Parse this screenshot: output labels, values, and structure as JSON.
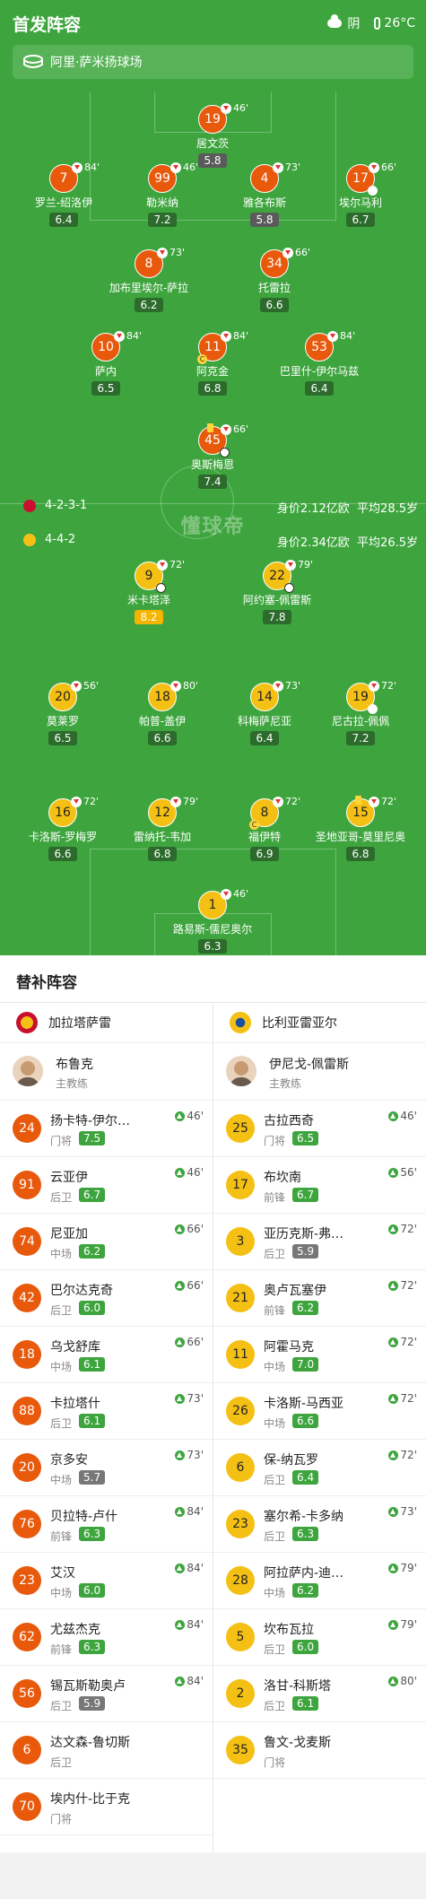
{
  "header": {
    "title": "首发阵容",
    "weather": "阴",
    "temperature": "26°C"
  },
  "stadium": "阿里·萨米扬球场",
  "pitch": {
    "watermark": "懂球帝",
    "home": {
      "formation": "4-2-3-1",
      "value": "身价2.12亿欧",
      "age": "平均28.5岁",
      "logo_color": "#c8102e"
    },
    "away": {
      "formation": "4-4-2",
      "value": "身价2.34亿欧",
      "age": "平均26.5岁",
      "logo_color": "#f5c014"
    },
    "home_players": [
      {
        "num": "19",
        "name": "居文茨",
        "rating": "5.8",
        "sub": "46'",
        "grey": true
      },
      {
        "num": "7",
        "name": "罗兰-绍洛伊",
        "rating": "6.4",
        "sub": "84'"
      },
      {
        "num": "99",
        "name": "勒米纳",
        "rating": "7.2",
        "sub": "46'"
      },
      {
        "num": "4",
        "name": "雅各布斯",
        "rating": "5.8",
        "sub": "73'",
        "grey": true
      },
      {
        "num": "17",
        "name": "埃尔马利",
        "rating": "6.7",
        "sub": "66'"
      },
      {
        "num": "8",
        "name": "加布里埃尔-萨拉",
        "rating": "6.2",
        "sub": "73'"
      },
      {
        "num": "34",
        "name": "托雷拉",
        "rating": "6.6",
        "sub": "66'"
      },
      {
        "num": "10",
        "name": "萨内",
        "rating": "6.5",
        "sub": "84'"
      },
      {
        "num": "11",
        "name": "阿克金",
        "rating": "6.8",
        "sub": "84'"
      },
      {
        "num": "53",
        "name": "巴里什-伊尔马兹",
        "rating": "6.4",
        "sub": "84'"
      },
      {
        "num": "45",
        "name": "奥斯梅恩",
        "rating": "7.4",
        "sub": "66'"
      }
    ],
    "away_players": [
      {
        "num": "9",
        "name": "米卡塔泽",
        "rating": "8.2",
        "sub": "72'"
      },
      {
        "num": "22",
        "name": "阿约塞-佩雷斯",
        "rating": "7.8",
        "sub": "79'"
      },
      {
        "num": "20",
        "name": "莫莱罗",
        "rating": "6.5",
        "sub": "56'"
      },
      {
        "num": "18",
        "name": "帕普-盖伊",
        "rating": "6.6",
        "sub": "80'"
      },
      {
        "num": "14",
        "name": "科梅萨尼亚",
        "rating": "6.4",
        "sub": "73'"
      },
      {
        "num": "19",
        "name": "尼古拉-佩佩",
        "rating": "7.2",
        "sub": "72'"
      },
      {
        "num": "16",
        "name": "卡洛斯-罗梅罗",
        "rating": "6.6",
        "sub": "72'"
      },
      {
        "num": "12",
        "name": "雷纳托-韦加",
        "rating": "6.8",
        "sub": "79'"
      },
      {
        "num": "8",
        "name": "福伊特",
        "rating": "6.9",
        "sub": "72'"
      },
      {
        "num": "15",
        "name": "圣地亚哥-莫里尼奥",
        "rating": "6.8",
        "sub": "72'"
      },
      {
        "num": "1",
        "name": "路易斯-儒尼奥尔",
        "rating": "6.3",
        "sub": "46'"
      }
    ]
  },
  "subs": {
    "title": "替补阵容",
    "home_team": "加拉塔萨雷",
    "away_team": "比利亚雷亚尔",
    "home_coach": {
      "name": "布鲁克",
      "role": "主教练"
    },
    "away_coach": {
      "name": "伊尼戈-佩雷斯",
      "role": "主教练"
    },
    "home": [
      {
        "num": "24",
        "name": "扬卡特-伊尔…",
        "pos": "门将",
        "rating": "7.5",
        "time": "46'"
      },
      {
        "num": "91",
        "name": "云亚伊",
        "pos": "后卫",
        "rating": "6.7",
        "time": "46'"
      },
      {
        "num": "74",
        "name": "尼亚加",
        "pos": "中场",
        "rating": "6.2",
        "time": "66'"
      },
      {
        "num": "42",
        "name": "巴尔达克奇",
        "pos": "后卫",
        "rating": "6.0",
        "time": "66'"
      },
      {
        "num": "18",
        "name": "乌戈舒库",
        "pos": "中场",
        "rating": "6.1",
        "time": "66'"
      },
      {
        "num": "88",
        "name": "卡拉塔什",
        "pos": "后卫",
        "rating": "6.1",
        "time": "73'"
      },
      {
        "num": "20",
        "name": "京多安",
        "pos": "中场",
        "rating": "5.7",
        "time": "73'",
        "grey": true
      },
      {
        "num": "76",
        "name": "贝拉特-卢什",
        "pos": "前锋",
        "rating": "6.3",
        "time": "84'"
      },
      {
        "num": "23",
        "name": "艾汉",
        "pos": "中场",
        "rating": "6.0",
        "time": "84'"
      },
      {
        "num": "62",
        "name": "尤兹杰克",
        "pos": "前锋",
        "rating": "6.3",
        "time": "84'"
      },
      {
        "num": "56",
        "name": "锡瓦斯勒奥卢",
        "pos": "后卫",
        "rating": "5.9",
        "time": "84'",
        "grey": true
      },
      {
        "num": "6",
        "name": "达文森-鲁切斯",
        "pos": "后卫"
      },
      {
        "num": "70",
        "name": "埃内什-比于克",
        "pos": "门将"
      }
    ],
    "away": [
      {
        "num": "25",
        "name": "古拉西奇",
        "pos": "门将",
        "rating": "6.5",
        "time": "46'"
      },
      {
        "num": "17",
        "name": "布坎南",
        "pos": "前锋",
        "rating": "6.7",
        "time": "56'"
      },
      {
        "num": "3",
        "name": "亚历克斯-弗…",
        "pos": "后卫",
        "rating": "5.9",
        "time": "72'",
        "grey": true
      },
      {
        "num": "21",
        "name": "奥卢瓦塞伊",
        "pos": "前锋",
        "rating": "6.2",
        "time": "72'"
      },
      {
        "num": "11",
        "name": "阿霍马克",
        "pos": "中场",
        "rating": "7.0",
        "time": "72'"
      },
      {
        "num": "26",
        "name": "卡洛斯-马西亚",
        "pos": "中场",
        "rating": "6.6",
        "time": "72'"
      },
      {
        "num": "6",
        "name": "保-纳瓦罗",
        "pos": "后卫",
        "rating": "6.4",
        "time": "72'"
      },
      {
        "num": "23",
        "name": "塞尔希-卡多纳",
        "pos": "后卫",
        "rating": "6.3",
        "time": "73'"
      },
      {
        "num": "28",
        "name": "阿拉萨内-迪…",
        "pos": "中场",
        "rating": "6.2",
        "time": "79'"
      },
      {
        "num": "5",
        "name": "坎布瓦拉",
        "pos": "后卫",
        "rating": "6.0",
        "time": "79'"
      },
      {
        "num": "2",
        "name": "洛甘-科斯塔",
        "pos": "后卫",
        "rating": "6.1",
        "time": "80'"
      },
      {
        "num": "35",
        "name": "鲁文-戈麦斯",
        "pos": "门将"
      }
    ]
  }
}
